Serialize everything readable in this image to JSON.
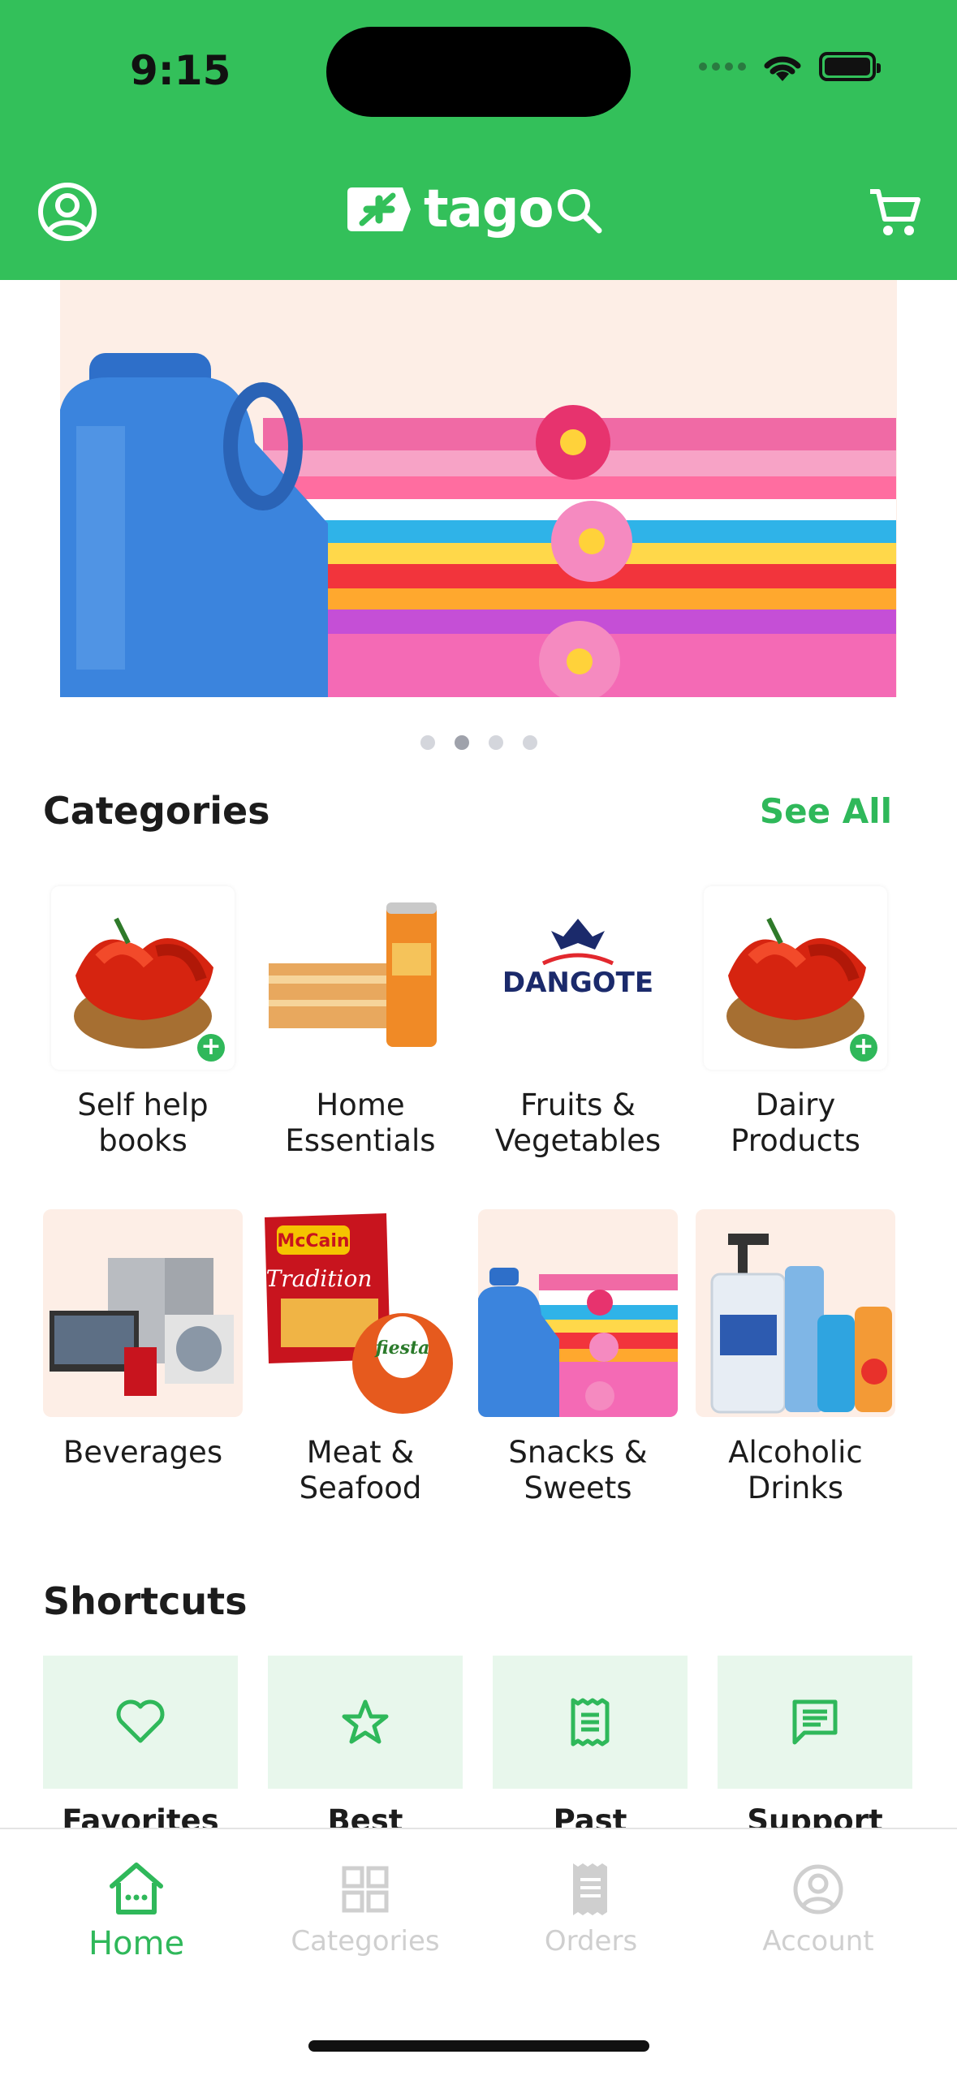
{
  "status_bar": {
    "time": "9:15"
  },
  "brand": {
    "name": "tago",
    "color": "#33c05a",
    "accent_text": "#2fb85a"
  },
  "header": {
    "left_icon": "profile-icon",
    "search_icon": "search-icon",
    "cart_icon": "cart-icon"
  },
  "banner": {
    "pages": 4,
    "active_page": 2
  },
  "categories": {
    "title": "Categories",
    "see_all": "See All",
    "items": [
      {
        "label": "Self help\nbooks",
        "image": "red-peppers-basket"
      },
      {
        "label": "Home\nEssentials",
        "image": "schweppes-cans"
      },
      {
        "label": "Fruits &\nVegetables",
        "image": "dangote-logo",
        "logo_text": "DANGOTE"
      },
      {
        "label": "Dairy\nProducts",
        "image": "red-peppers-basket"
      },
      {
        "label": "Beverages",
        "image": "home-appliances"
      },
      {
        "label": "Meat &\nSeafood",
        "image": "mccain-fiesta",
        "pack_text_1": "McCain",
        "pack_text_2": "Tradition",
        "pack_text_3": "fiesta"
      },
      {
        "label": "Snacks &\nSweets",
        "image": "detergent-towels"
      },
      {
        "label": "Alcoholic\nDrinks",
        "image": "purell-glade"
      }
    ]
  },
  "shortcuts": {
    "title": "Shortcuts",
    "items": [
      {
        "label": "Favorites",
        "icon": "heart-icon"
      },
      {
        "label": "Best Sellers",
        "icon": "star-icon"
      },
      {
        "label": "Past Orders",
        "icon": "receipt-icon"
      },
      {
        "label": "Support",
        "icon": "chat-icon"
      }
    ]
  },
  "tabbar": {
    "items": [
      {
        "label": "Home",
        "icon": "home-icon",
        "active": true
      },
      {
        "label": "Categories",
        "icon": "grid-icon",
        "active": false
      },
      {
        "label": "Orders",
        "icon": "receipt-icon",
        "active": false
      },
      {
        "label": "Account",
        "icon": "profile-icon",
        "active": false
      }
    ]
  }
}
